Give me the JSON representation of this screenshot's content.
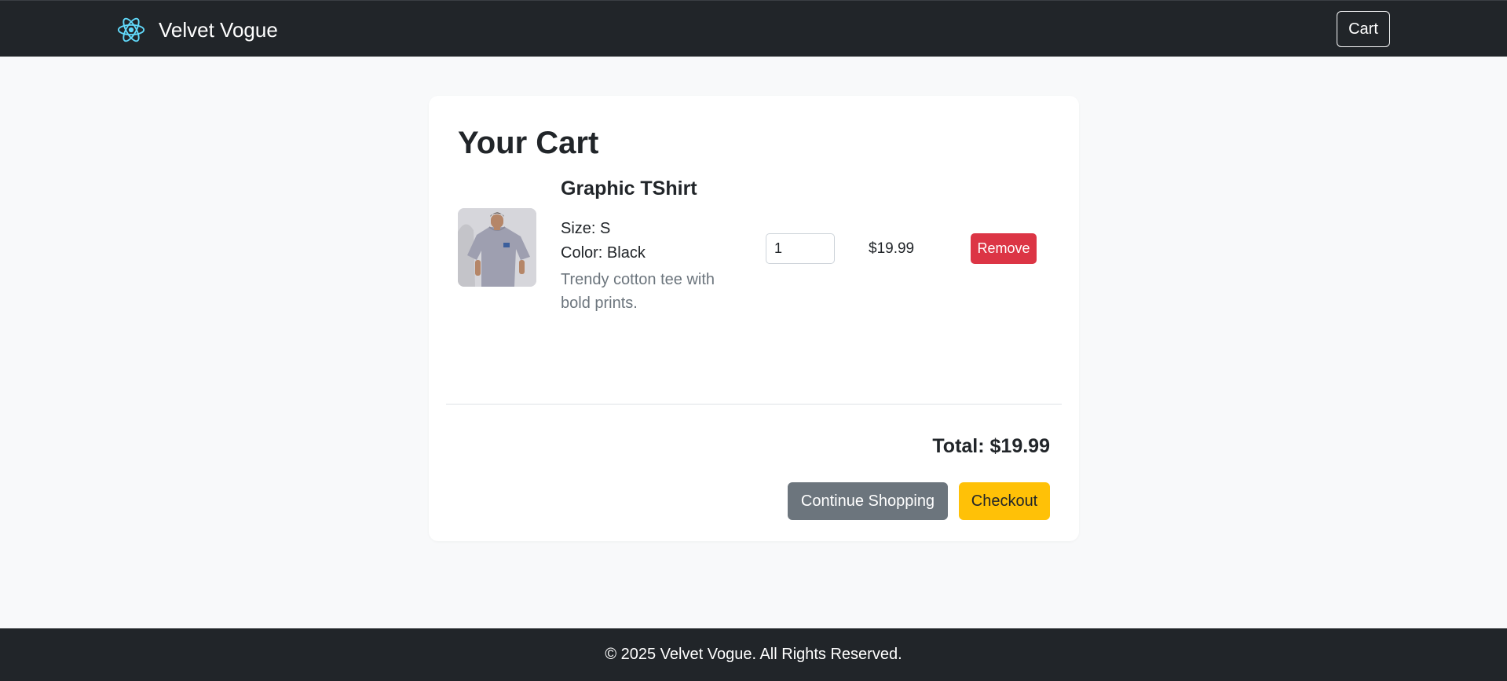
{
  "navbar": {
    "brand_name": "Velvet Vogue",
    "brand_icon": "react-atom-icon",
    "cart_label": "Cart"
  },
  "cart": {
    "title": "Your Cart",
    "items": [
      {
        "name": "Graphic TShirt",
        "size": "Size: S",
        "color": "Color: Black",
        "description": "Trendy cotton tee with bold prints.",
        "quantity": "1",
        "price": "$19.99",
        "remove_label": "Remove",
        "image": "grey-tshirt-model-photo"
      }
    ],
    "total": "Total: $19.99",
    "continue_label": "Continue Shopping",
    "checkout_label": "Checkout"
  },
  "footer": {
    "text": "© 2025 Velvet Vogue. All Rights Reserved."
  },
  "colors": {
    "navbar_bg": "#212529",
    "page_bg": "#f8f9fa",
    "remove": "#dc3545",
    "continue": "#6c757d",
    "checkout": "#ffc107",
    "brand_icon": "#61dafb"
  }
}
